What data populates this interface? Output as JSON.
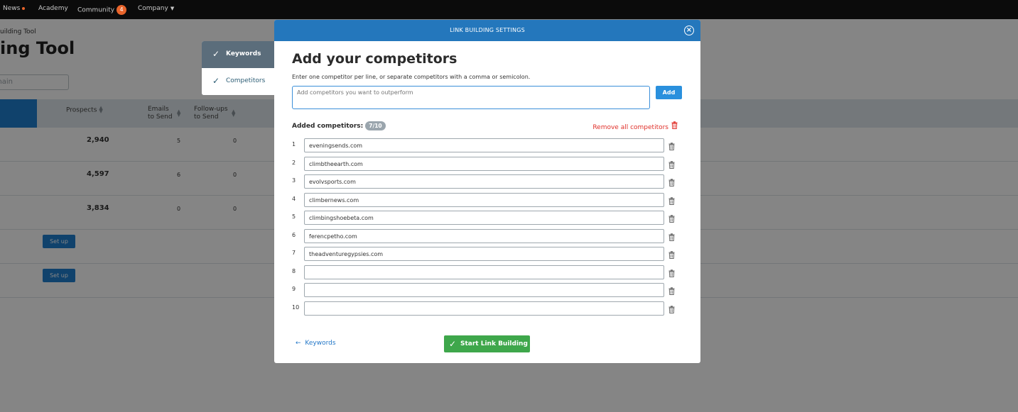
{
  "topbar": {
    "items": [
      {
        "label": "News"
      },
      {
        "label": "Academy"
      },
      {
        "label": "Community",
        "badge": "4"
      },
      {
        "label": "Company"
      }
    ]
  },
  "page": {
    "breadcrumb": "uilding Tool",
    "title": "ing Tool",
    "domain_placeholder": "main"
  },
  "table": {
    "headers": {
      "prospects": "Prospects",
      "emails_line1": "Emails",
      "emails_line2": "to Send",
      "followups_line1": "Follow-ups",
      "followups_line2": "to Send"
    },
    "rows": [
      {
        "prospects": "2,940",
        "emails": "5",
        "followups": "0"
      },
      {
        "prospects": "4,597",
        "emails": "6",
        "followups": "0"
      },
      {
        "prospects": "3,834",
        "emails": "0",
        "followups": "0"
      }
    ],
    "setup_label": "Set up"
  },
  "stepper": {
    "steps": [
      {
        "label": "Keywords",
        "state": "done"
      },
      {
        "label": "Competitors",
        "state": "current"
      }
    ]
  },
  "modal": {
    "header": "LINK BUILDING SETTINGS",
    "title": "Add your competitors",
    "description": "Enter one competitor per line, or separate competitors with a comma or semicolon.",
    "input_placeholder": "Add competitors you want to outperform",
    "add_label": "Add",
    "added_label": "Added competitors:",
    "count": "7/10",
    "remove_all_label": "Remove all competitors",
    "competitors": [
      {
        "num": "1",
        "value": "eveningsends.com"
      },
      {
        "num": "2",
        "value": "climbtheearth.com"
      },
      {
        "num": "3",
        "value": "evolvsports.com"
      },
      {
        "num": "4",
        "value": "climbernews.com"
      },
      {
        "num": "5",
        "value": "climbingshoebeta.com"
      },
      {
        "num": "6",
        "value": "ferencpetho.com"
      },
      {
        "num": "7",
        "value": "theadventuregypsies.com"
      },
      {
        "num": "8",
        "value": ""
      },
      {
        "num": "9",
        "value": ""
      },
      {
        "num": "10",
        "value": ""
      }
    ],
    "back_label": "Keywords",
    "start_label": "Start Link Building"
  },
  "colors": {
    "header_blue": "#2477bc",
    "start_green": "#3ea74b",
    "remove_red": "#e0302a",
    "accent_orange": "#e8642b"
  },
  "icons": [
    "close-icon",
    "check-icon",
    "trash-icon",
    "arrow-left-icon",
    "sort-icon",
    "caret-down-icon"
  ]
}
